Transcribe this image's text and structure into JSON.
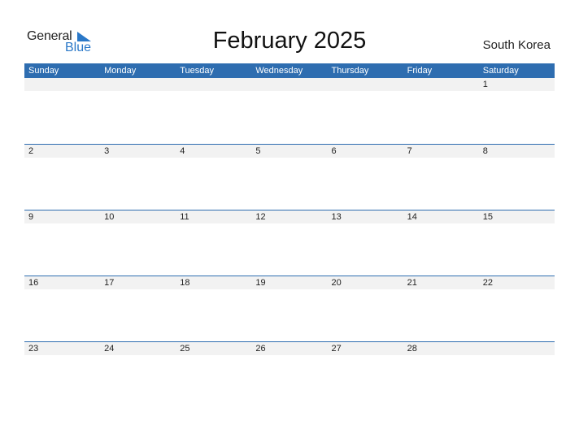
{
  "logo": {
    "line1": "General",
    "line2": "Blue"
  },
  "title": "February 2025",
  "country": "South Korea",
  "colors": {
    "header": "#2e6db0",
    "band": "#f2f2f2",
    "logo_blue": "#2a78c8"
  },
  "weekdays": [
    "Sunday",
    "Monday",
    "Tuesday",
    "Wednesday",
    "Thursday",
    "Friday",
    "Saturday"
  ],
  "weeks": [
    [
      "",
      "",
      "",
      "",
      "",
      "",
      "1"
    ],
    [
      "2",
      "3",
      "4",
      "5",
      "6",
      "7",
      "8"
    ],
    [
      "9",
      "10",
      "11",
      "12",
      "13",
      "14",
      "15"
    ],
    [
      "16",
      "17",
      "18",
      "19",
      "20",
      "21",
      "22"
    ],
    [
      "23",
      "24",
      "25",
      "26",
      "27",
      "28",
      ""
    ]
  ]
}
